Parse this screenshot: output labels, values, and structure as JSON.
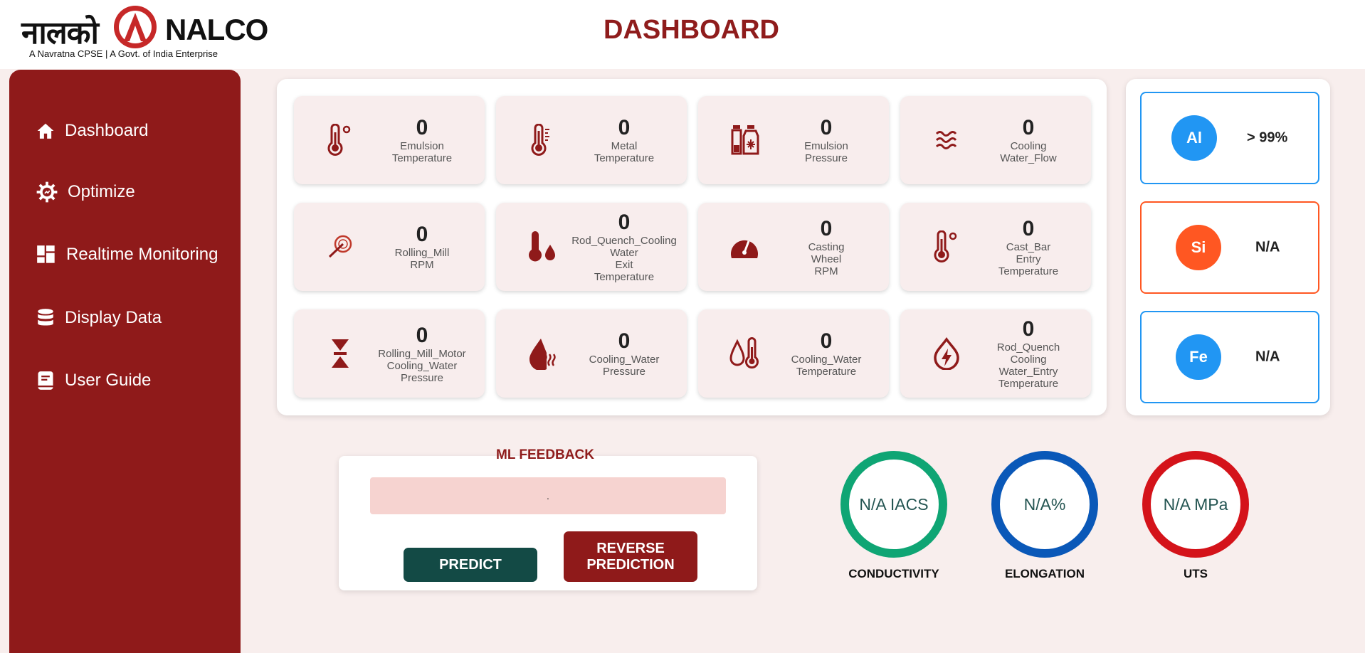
{
  "header": {
    "logo_hindi": "नालको",
    "logo_name": "NALCO",
    "logo_tagline": "A Navratna CPSE | A Govt. of India Enterprise",
    "page_title": "DASHBOARD"
  },
  "sidebar": {
    "items": [
      {
        "label": "Dashboard",
        "icon": "home-icon"
      },
      {
        "label": "Optimize",
        "icon": "gear-icon"
      },
      {
        "label": "Realtime Monitoring",
        "icon": "dashboard-grid-icon"
      },
      {
        "label": "Display Data",
        "icon": "database-icon"
      },
      {
        "label": "User Guide",
        "icon": "book-icon"
      }
    ]
  },
  "sensors": [
    {
      "value": "0",
      "label": "Emulsion\nTemperature",
      "icon": "thermometer-degree-icon"
    },
    {
      "value": "0",
      "label": "Metal\nTemperature",
      "icon": "thermometer-icon"
    },
    {
      "value": "0",
      "label": "Emulsion\nPressure",
      "icon": "bottles-icon"
    },
    {
      "value": "0",
      "label": "Cooling\nWater_Flow",
      "icon": "water-waves-icon"
    },
    {
      "value": "0",
      "label": "Rolling_Mill\nRPM",
      "icon": "speedometer-icon"
    },
    {
      "value": "0",
      "label": "Rod_Quench_Cooling\nWater\nExit\nTemperature",
      "icon": "temperature-drop-icon"
    },
    {
      "value": "0",
      "label": "Casting\nWheel\nRPM",
      "icon": "gauge-icon"
    },
    {
      "value": "0",
      "label": "Cast_Bar\nEntry\nTemperature",
      "icon": "thermometer-degree-icon"
    },
    {
      "value": "0",
      "label": "Rolling_Mill_Motor\nCooling_Water\nPressure",
      "icon": "compress-arrows-icon"
    },
    {
      "value": "0",
      "label": "Cooling_Water\nPressure",
      "icon": "water-heat-icon"
    },
    {
      "value": "0",
      "label": "Cooling_Water\nTemperature",
      "icon": "droplet-thermometer-icon"
    },
    {
      "value": "0",
      "label": "Rod_Quench\nCooling\nWater_Entry\nTemperature",
      "icon": "bolt-drop-icon"
    }
  ],
  "elements": [
    {
      "symbol": "Al",
      "value": "> 99%",
      "color": "#2196f3"
    },
    {
      "symbol": "Si",
      "value": "N/A",
      "color": "#ff5722"
    },
    {
      "symbol": "Fe",
      "value": "N/A",
      "color": "#2196f3"
    }
  ],
  "feedback": {
    "title": "ML FEEDBACK",
    "value": ".",
    "predict_label": "PREDICT",
    "reverse_label": "REVERSE\nPREDICTION",
    "predict_color": "#134a45",
    "reverse_color": "#8f1a1a"
  },
  "gauges": [
    {
      "value": "N/A IACS",
      "label": "CONDUCTIVITY",
      "color": "#0fa574"
    },
    {
      "value": "N/A%",
      "label": "ELONGATION",
      "color": "#0a58b8"
    },
    {
      "value": "N/A MPa",
      "label": "UTS",
      "color": "#d4131a"
    }
  ],
  "colors": {
    "brand": "#8f1a1a",
    "background": "#f8eeed"
  }
}
